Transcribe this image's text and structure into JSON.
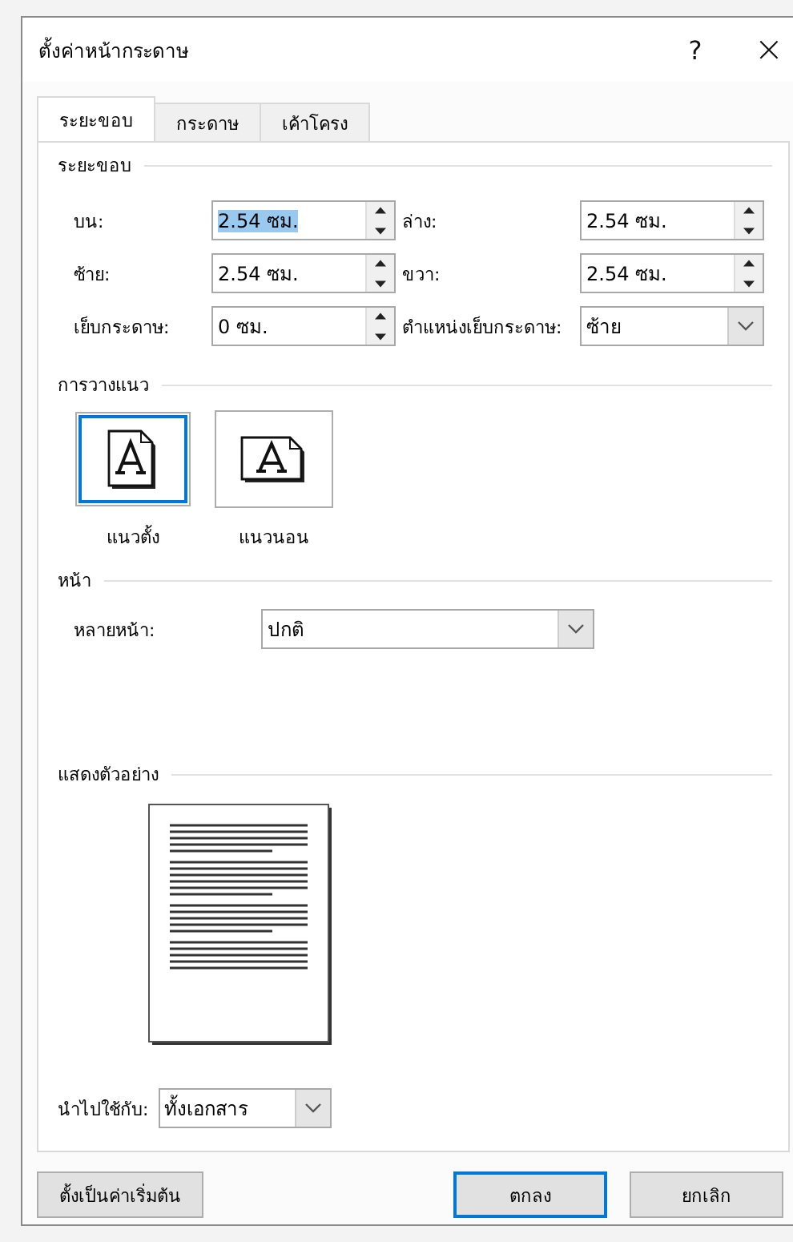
{
  "window": {
    "title": "ตั้งค่าหน้ากระดาษ",
    "help": "?",
    "close": "×"
  },
  "tabs": [
    {
      "label": "ระยะขอบ",
      "selected": true
    },
    {
      "label": "กระดาษ",
      "selected": false
    },
    {
      "label": "เค้าโครง",
      "selected": false
    }
  ],
  "margins": {
    "heading": "ระยะขอบ",
    "fields": [
      {
        "label": "บน:",
        "value": "2.54 ซม.",
        "kind": "spin",
        "highlighted": true
      },
      {
        "label": "ล่าง:",
        "value": "2.54 ซม.",
        "kind": "spin",
        "highlighted": false
      },
      {
        "label": "ซ้าย:",
        "value": "2.54 ซม.",
        "kind": "spin",
        "highlighted": false
      },
      {
        "label": "ขวา:",
        "value": "2.54 ซม.",
        "kind": "spin",
        "highlighted": false
      },
      {
        "label": "เย็บกระดาษ:",
        "value": "0 ซม.",
        "kind": "spin",
        "highlighted": false
      },
      {
        "label": "ตำแหน่งเย็บกระดาษ:",
        "value": "ซ้าย",
        "kind": "dropdown",
        "highlighted": false
      }
    ]
  },
  "orientation": {
    "heading": "การวางแนว",
    "options": [
      {
        "label": "แนวตั้ง",
        "kind": "portrait",
        "selected": true
      },
      {
        "label": "แนวนอน",
        "kind": "landscape",
        "selected": false
      }
    ]
  },
  "pages": {
    "heading": "หน้า",
    "label": "หลายหน้า:",
    "value": "ปกติ"
  },
  "preview": {
    "heading": "แสดงตัวอย่าง"
  },
  "apply_to": {
    "label": "นำไปใช้กับ:",
    "value": "ทั้งเอกสาร"
  },
  "buttons": [
    {
      "label": "ตั้งเป็นค่าเริ่มต้น",
      "kind": "default"
    },
    {
      "label": "ตกลง",
      "kind": "ok"
    },
    {
      "label": "ยกเลิก",
      "kind": "cancel"
    }
  ]
}
